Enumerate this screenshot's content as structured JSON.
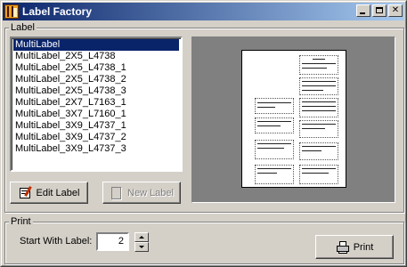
{
  "window": {
    "title": "Label Factory"
  },
  "icons": {
    "app": "label-factory-app-icon",
    "minimize": "minimize-icon",
    "maximize": "maximize-icon",
    "close": "close-icon",
    "edit": "edit-label-icon",
    "new": "new-label-icon",
    "print": "printer-icon"
  },
  "label_group": {
    "legend": "Label",
    "items": [
      "MultiLabel",
      "MultiLabel_2X5_L4738",
      "MultiLabel_2X5_L4738_1",
      "MultiLabel_2X5_L4738_2",
      "MultiLabel_2X5_L4738_3",
      "MultiLabel_2X7_L7163_1",
      "MultiLabel_3X7_L7160_1",
      "MultiLabel_3X9_L4737_1",
      "MultiLabel_3X9_L4737_2",
      "MultiLabel_3X9_L4737_3"
    ],
    "selected_index": 0,
    "edit_button": "Edit Label",
    "new_button": "New Label"
  },
  "print_group": {
    "legend": "Print",
    "start_label": "Start With Label:",
    "start_value": "2",
    "print_button": "Print"
  },
  "colors": {
    "titlebar_start": "#0a246a",
    "titlebar_end": "#a6caf0",
    "selection": "#0a246a",
    "face": "#d4d0c8",
    "preview_bg": "#808080"
  }
}
